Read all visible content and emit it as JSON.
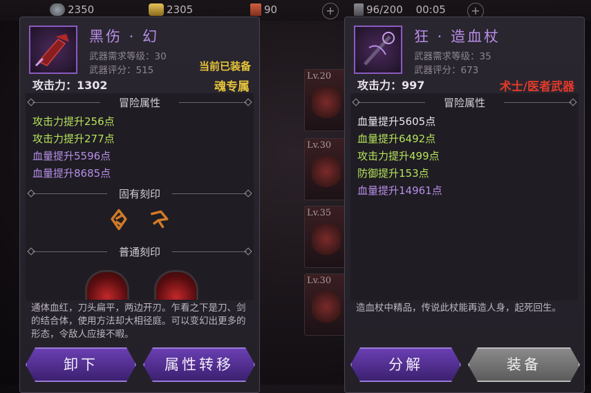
{
  "topbar": {
    "resources": [
      {
        "icon": "silver-coin-icon",
        "value": "2350"
      },
      {
        "icon": "gold-ingot-icon",
        "value": "2305"
      },
      {
        "icon": "card-icon",
        "value": "90"
      },
      {
        "icon": "energy-icon",
        "value": "96/200"
      }
    ],
    "timer": "00:05"
  },
  "bg_slots": [
    {
      "level": "Lv.20"
    },
    {
      "level": "Lv.30"
    },
    {
      "level": "Lv.35"
    },
    {
      "level": "Lv.30"
    }
  ],
  "left": {
    "name": "黑伤 · 幻",
    "req_level": "武器需求等级：30",
    "score": "武器评分：515",
    "equipped": "当前已装备",
    "attack": "攻击力：1302",
    "tag": "魂专属",
    "adventure_header": "冒险属性",
    "attrs": [
      {
        "text": "攻击力提升256点",
        "color": "green"
      },
      {
        "text": "攻击力提升277点",
        "color": "green"
      },
      {
        "text": "血量提升5596点",
        "color": "purple"
      },
      {
        "text": "血量提升8685点",
        "color": "purple"
      }
    ],
    "inherent_header": "固有刻印",
    "normal_header": "普通刻印",
    "description": "通体血红，刀头扁平，两边开刃。乍看之下是刀、剑的结合体，使用方法却大相径庭。可以变幻出更多的形态，令敌人应接不暇。",
    "btn_unequip": "卸下",
    "btn_transfer": "属性转移"
  },
  "right": {
    "name": "狂 · 造血杖",
    "req_level": "武器需求等级：35",
    "score": "武器评分：673",
    "attack": "攻击力：997",
    "tag": "术士/医者武器",
    "adventure_header": "冒险属性",
    "attrs": [
      {
        "text": "血量提升5605点",
        "color": "white"
      },
      {
        "text": "血量提升6492点",
        "color": "green"
      },
      {
        "text": "攻击力提升499点",
        "color": "green"
      },
      {
        "text": "防御提升153点",
        "color": "green"
      },
      {
        "text": "血量提升14961点",
        "color": "purple"
      }
    ],
    "description": "造血杖中精品，传说此杖能再造人身，起死回生。",
    "btn_decompose": "分解",
    "btn_equip": "装备"
  },
  "colors": {
    "green": "#b6e35a",
    "purple": "#b78fe6",
    "gold": "#e7c53a",
    "red": "#e23a2c"
  }
}
